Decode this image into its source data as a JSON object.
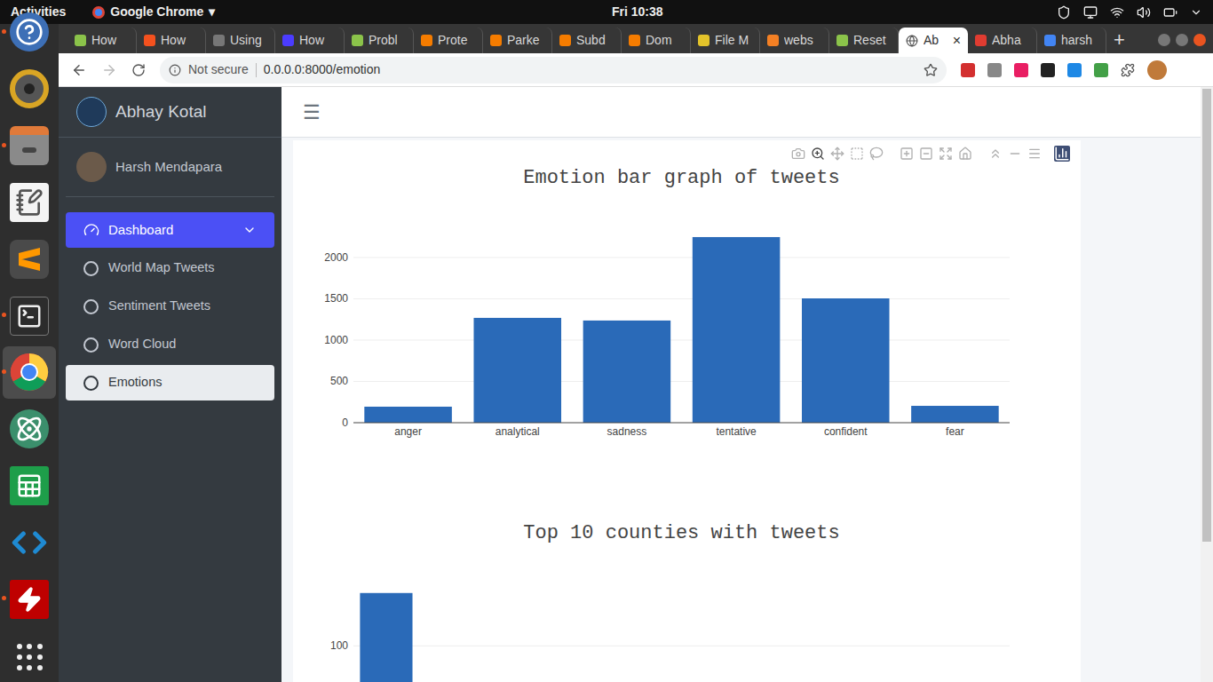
{
  "topbar": {
    "activities": "Activities",
    "app": "Google Chrome",
    "app_caret": "▾",
    "clock": "Fri 10:38"
  },
  "dock": [
    {
      "kind": "help",
      "running": true,
      "active": false
    },
    {
      "kind": "speaker",
      "running": false,
      "active": false
    },
    {
      "kind": "files",
      "running": true,
      "active": false
    },
    {
      "kind": "editor",
      "running": false,
      "active": false
    },
    {
      "kind": "sublime",
      "running": false,
      "active": false
    },
    {
      "kind": "terminal",
      "running": true,
      "active": false
    },
    {
      "kind": "chrome",
      "running": true,
      "active": true
    },
    {
      "kind": "atom",
      "running": false,
      "active": false
    },
    {
      "kind": "calc",
      "running": false,
      "active": false
    },
    {
      "kind": "vscode",
      "running": false,
      "active": false
    },
    {
      "kind": "filezilla",
      "running": true,
      "active": false
    },
    {
      "kind": "apps",
      "running": false,
      "active": false
    }
  ],
  "browser": {
    "tabs": [
      {
        "label": "How",
        "selected": false,
        "color": "#8bc34a"
      },
      {
        "label": "How",
        "selected": false,
        "color": "#f4511e"
      },
      {
        "label": "Using",
        "selected": false,
        "color": "#777777"
      },
      {
        "label": "How",
        "selected": false,
        "color": "#4b3cff"
      },
      {
        "label": "Probl",
        "selected": false,
        "color": "#8bc34a"
      },
      {
        "label": "Prote",
        "selected": false,
        "color": "#f57c00"
      },
      {
        "label": "Parke",
        "selected": false,
        "color": "#f57c00"
      },
      {
        "label": "Subd",
        "selected": false,
        "color": "#f57c00"
      },
      {
        "label": "Dom",
        "selected": false,
        "color": "#f57c00"
      },
      {
        "label": "File M",
        "selected": false,
        "color": "#e3c32a"
      },
      {
        "label": "webs",
        "selected": false,
        "color": "#f48024"
      },
      {
        "label": "Reset",
        "selected": false,
        "color": "#8bc34a"
      },
      {
        "label": "Ab",
        "selected": true,
        "color": "#555555"
      },
      {
        "label": "Abha",
        "selected": false,
        "color": "#e03c31"
      },
      {
        "label": "harsh",
        "selected": false,
        "color": "#4285f4"
      }
    ],
    "tab_close": "×",
    "new_tab": "+",
    "security": "Not secure",
    "url": "0.0.0.0:8000/emotion"
  },
  "sidebar": {
    "brand": "Abhay Kotal",
    "user": "Harsh Mendapara",
    "menu": {
      "label": "Dashboard",
      "expanded": true,
      "selected": true
    },
    "items": [
      {
        "label": "World Map Tweets",
        "selected": false
      },
      {
        "label": "Sentiment Tweets",
        "selected": false
      },
      {
        "label": "Word Cloud",
        "selected": false
      },
      {
        "label": "Emotions",
        "selected": true
      }
    ]
  },
  "navbar": {
    "toggle": "☰"
  },
  "charts": [
    {
      "title": "Emotion bar graph of tweets",
      "categories": [
        "anger",
        "analytical",
        "sadness",
        "tentative",
        "confident",
        "fear"
      ],
      "values": [
        194,
        1269,
        1237,
        2247,
        1505,
        204
      ],
      "ticks": [
        "0",
        "500",
        "1000",
        "1500",
        "2000"
      ],
      "y_max": 2494,
      "modebar": true
    },
    {
      "title": "Top 10 counties with tweets",
      "categories": [],
      "values": [
        140
      ],
      "ticks": [
        "100"
      ],
      "y_max": 156,
      "modebar": false
    }
  ]
}
